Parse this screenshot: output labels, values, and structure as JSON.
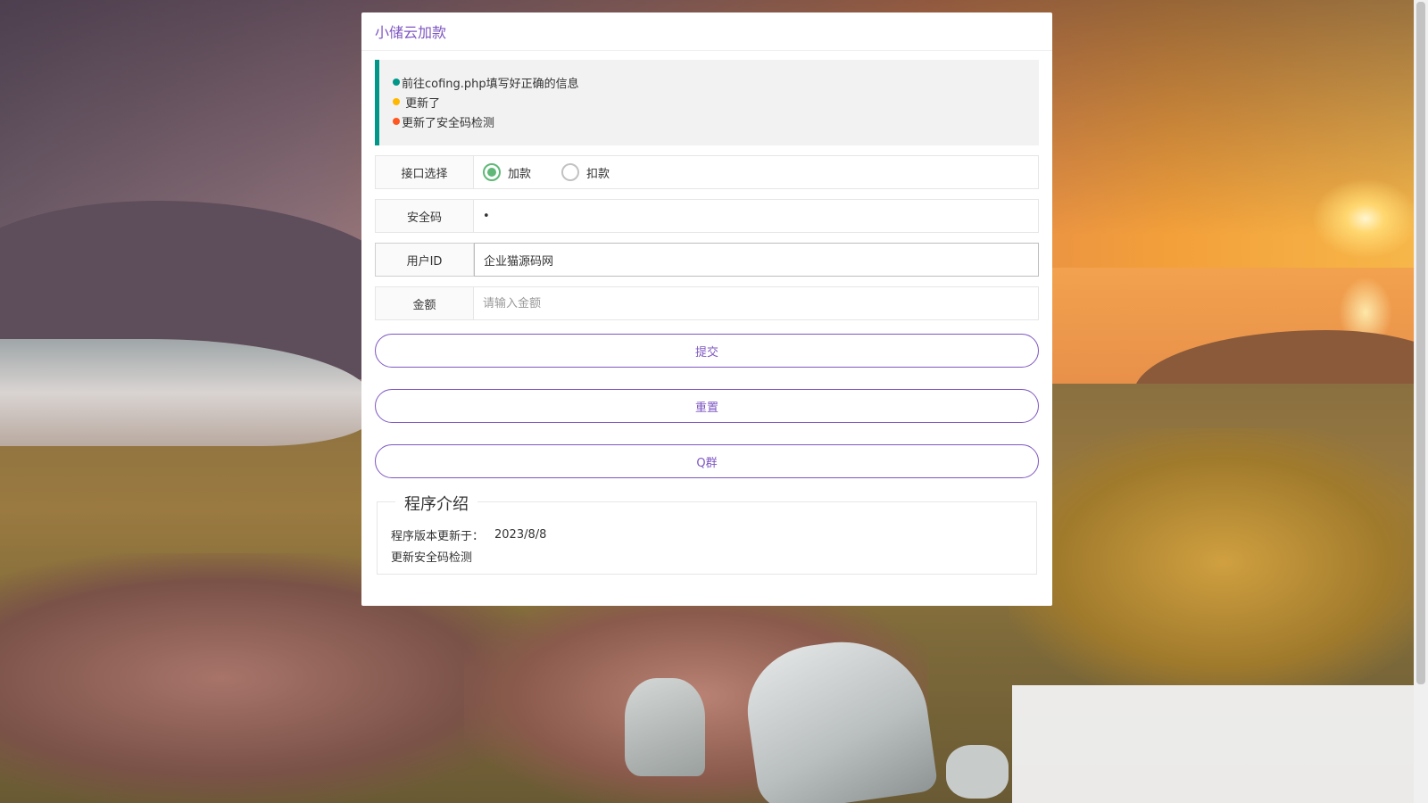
{
  "header": {
    "title": "小储云加款"
  },
  "notice": {
    "items": [
      {
        "text": "前往cofing.php填写好正确的信息",
        "color": "#009688"
      },
      {
        "text": " 更新了",
        "color": "#ffb800"
      },
      {
        "text": "更新了安全码检测",
        "color": "#ff5722"
      }
    ]
  },
  "form": {
    "interface": {
      "label": "接口选择",
      "options": [
        {
          "label": "加款",
          "checked": true
        },
        {
          "label": "扣款",
          "checked": false
        }
      ]
    },
    "security_code": {
      "label": "安全码",
      "value": "•"
    },
    "user_id": {
      "label": "用户ID",
      "value": "企业猫源码网"
    },
    "amount": {
      "label": "金额",
      "placeholder": "请输入金额",
      "value": ""
    }
  },
  "buttons": {
    "submit": "提交",
    "reset": "重置",
    "qq_group": "Q群"
  },
  "intro": {
    "legend": "程序介绍",
    "version_label": "程序版本更新于：",
    "version_date": "2023/8/8",
    "note": "更新安全码检测"
  },
  "colors": {
    "accent": "#7e57c2",
    "notice_border": "#009688",
    "radio_checked": "#5fb878"
  }
}
